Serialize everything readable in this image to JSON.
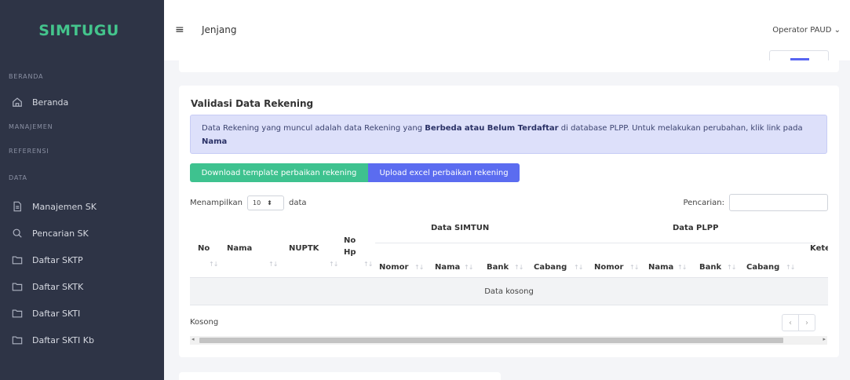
{
  "sidebar": {
    "brand": "SIMTUGU",
    "sections": [
      {
        "header": "BERANDA",
        "items": [
          {
            "label": "Beranda",
            "icon": "home-icon"
          }
        ]
      },
      {
        "header": "MANAJEMEN",
        "items": []
      },
      {
        "header": "REFERENSI",
        "items": []
      },
      {
        "header": "DATA",
        "items": [
          {
            "label": "Manajemen SK",
            "icon": "document-icon"
          },
          {
            "label": "Pencarian SK",
            "icon": "search-icon"
          },
          {
            "label": "Daftar SKTP",
            "icon": "folder-icon"
          },
          {
            "label": "Daftar SKTK",
            "icon": "folder-icon"
          },
          {
            "label": "Daftar SKTI",
            "icon": "folder-icon"
          },
          {
            "label": "Daftar SKTI Kb",
            "icon": "folder-icon"
          }
        ]
      }
    ]
  },
  "topbar": {
    "menu_icon": "≡",
    "page_name": "Jenjang",
    "user": "Operator PAUD ⌄"
  },
  "card": {
    "title": "Validasi Data Rekening",
    "alert": {
      "part1": "Data Rekening yang muncul adalah data Rekening yang ",
      "bold1": "Berbeda atau Belum Terdaftar",
      "part2": " di database PLPP. Untuk melakukan perubahan, klik link pada ",
      "bold2": "Nama"
    },
    "btn_download": "Download template perbaikan rekening",
    "btn_upload": "Upload excel perbaikan rekening",
    "length_prefix": "Menampilkan",
    "length_value": "10",
    "length_arrow": "⬍",
    "length_suffix": "data",
    "search_label": "Pencarian:",
    "table": {
      "group_simtun": "Data SIMTUN",
      "group_plpp": "Data PLPP",
      "col_no": "No",
      "col_nama": "Nama",
      "col_nuptk": "NUPTK",
      "col_nohp_1": "No",
      "col_nohp_2": "Hp",
      "col_ket": "Kete",
      "sub_cols": [
        "Nomor",
        "Nama",
        "Bank",
        "Cabang",
        "Nomor",
        "Nama",
        "Bank",
        "Cabang"
      ],
      "sort_glyph": "↑↓",
      "empty": "Data kosong"
    },
    "info": "Kosong",
    "prev": "‹",
    "next": "›"
  }
}
